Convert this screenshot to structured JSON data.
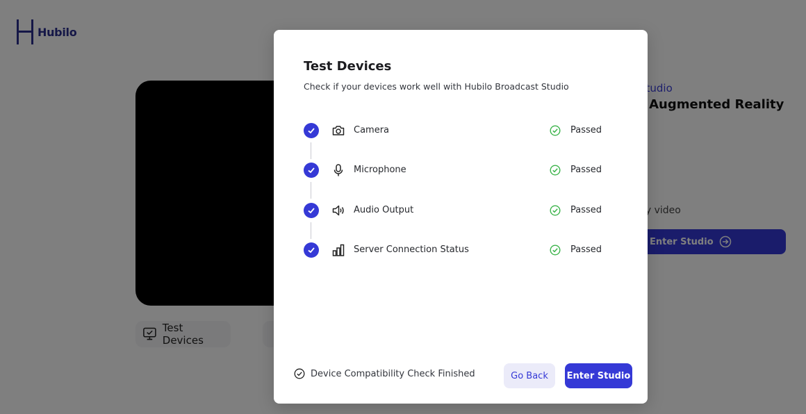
{
  "app": {
    "logo_text": "Hubilo",
    "brand_color": "#3539d6"
  },
  "background": {
    "test_devices_label": "Test Devices",
    "session_subtitle": "Studio",
    "session_title": "f Augmented Reality",
    "note_text": "ny video",
    "enter_studio_label": "Enter Studio"
  },
  "modal": {
    "title": "Test Devices",
    "subtitle": "Check if your devices work well with Hubilo Broadcast Studio",
    "checks": [
      {
        "label": "Camera",
        "icon": "camera-icon",
        "status": "Passed"
      },
      {
        "label": "Microphone",
        "icon": "microphone-icon",
        "status": "Passed"
      },
      {
        "label": "Audio Output",
        "icon": "speaker-icon",
        "status": "Passed"
      },
      {
        "label": "Server Connection Status",
        "icon": "signal-bars-icon",
        "status": "Passed"
      }
    ],
    "footer_status": "Device Compatibility Check Finished",
    "go_back_label": "Go Back",
    "enter_studio_label": "Enter Studio",
    "status_color": "#3cb44b"
  }
}
